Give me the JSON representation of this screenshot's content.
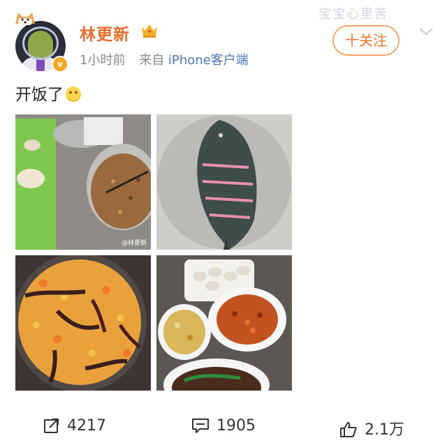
{
  "header": {
    "username": "林更新",
    "time": "1小时前",
    "from_label": "来自",
    "client": "iPhone客户端",
    "follow_label": "十关注",
    "watermark": "宝宝心里苦"
  },
  "post": {
    "text": "开饭了"
  },
  "images": [
    {
      "name": "dumpling-prep-photo",
      "caption": "@林更新"
    },
    {
      "name": "fish-photo"
    },
    {
      "name": "spicy-pot-photo"
    },
    {
      "name": "dinner-table-photo"
    }
  ],
  "stats": {
    "reposts": "4217",
    "comments": "1905",
    "likes": "2.1万"
  },
  "icons": [
    "repost-icon",
    "comment-icon",
    "like-icon",
    "chevron-down-icon",
    "crown-icon"
  ],
  "colors": {
    "username": "#e86a2a",
    "client_link": "#4c77b8",
    "follow_border": "#f0a66a"
  }
}
